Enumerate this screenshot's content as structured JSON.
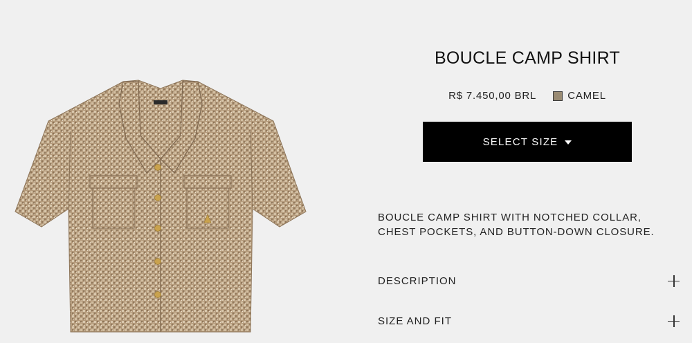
{
  "product": {
    "name": "BOUCLE CAMP SHIRT",
    "price": "R$ 7.450,00 BRL",
    "color": {
      "name": "CAMEL",
      "swatch_hex": "#9a8b73"
    },
    "select_size_label": "SELECT SIZE",
    "summary_lines": [
      "BOUCLE CAMP SHIRT WITH NOTCHED COLLAR,",
      "CHEST POCKETS, AND BUTTON-DOWN CLOSURE."
    ],
    "accordions": [
      {
        "label": "DESCRIPTION",
        "icon": "plus-icon"
      },
      {
        "label": "SIZE AND FIT",
        "icon": "plus-icon"
      }
    ]
  },
  "colors": {
    "background": "#f0f0f0",
    "button_bg": "#000000",
    "button_text": "#ffffff",
    "fabric": "#b79e80",
    "buttons_gold": "#c9a24e"
  }
}
